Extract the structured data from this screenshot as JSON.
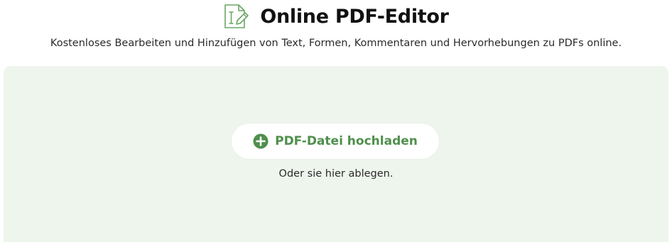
{
  "header": {
    "title": "Online PDF-Editor",
    "icon": "pdf-edit-icon",
    "subtitle": "Kostenloses Bearbeiten und Hinzufügen von Text, Formen, Kommentaren und Hervorhebungen zu PDFs online."
  },
  "dropzone": {
    "upload_label": "PDF-Datei hochladen",
    "upload_icon": "plus-circle-icon",
    "hint": "Oder sie hier ablegen."
  },
  "colors": {
    "accent": "#4f8f4c",
    "dropzone_bg": "#eef5ed",
    "icon_stroke": "#6aa566"
  }
}
